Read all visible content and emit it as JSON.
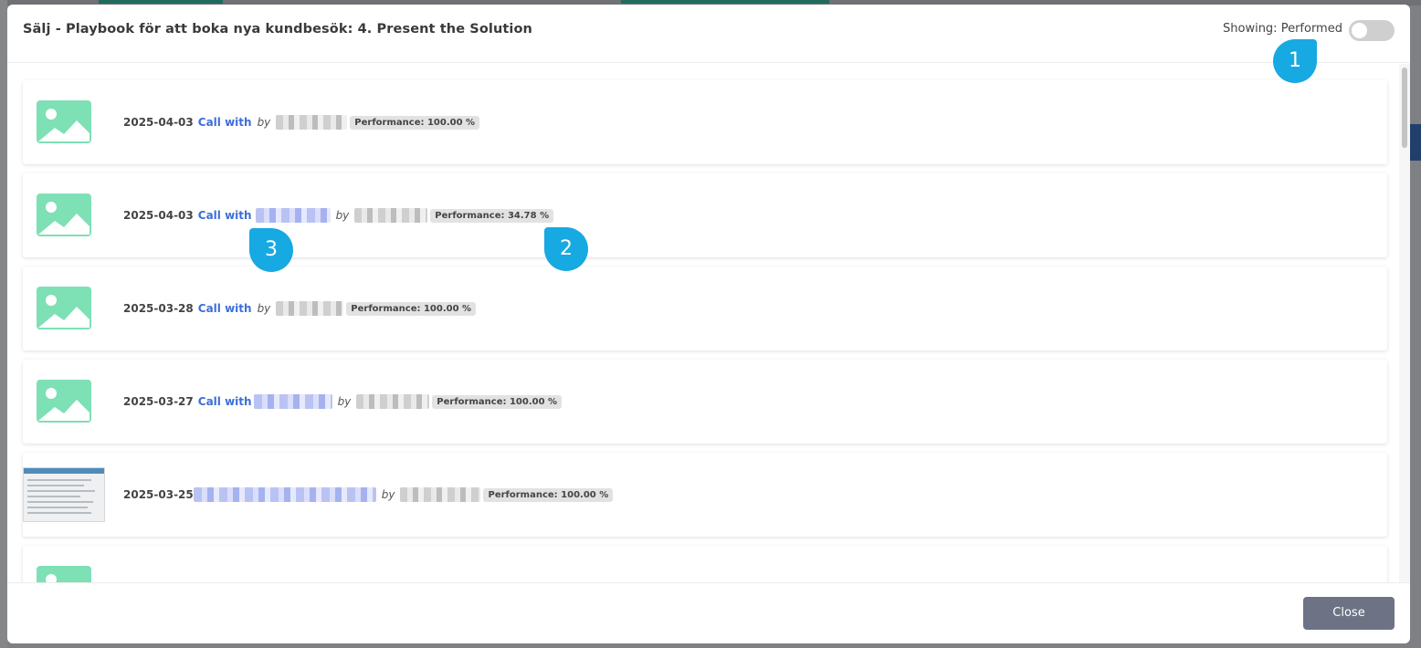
{
  "modal": {
    "title": "Sälj - Playbook för att boka nya kundbesök: 4. Present the Solution",
    "showing_label": "Showing: Performed",
    "toggle_on": false
  },
  "rows": [
    {
      "date": "2025-04-03",
      "call_with": "Call with",
      "by": "by",
      "performance": "Performance: 100.00 %",
      "thumbnail": "image-placeholder-icon"
    },
    {
      "date": "2025-04-03",
      "call_with": "Call with",
      "by": "by",
      "performance": "Performance: 34.78 %",
      "thumbnail": "image-placeholder-icon"
    },
    {
      "date": "2025-03-28",
      "call_with": "Call with",
      "by": "by",
      "performance": "Performance: 100.00 %",
      "thumbnail": "image-placeholder-icon"
    },
    {
      "date": "2025-03-27",
      "call_with": "Call with",
      "by": "by",
      "performance": "Performance: 100.00 %",
      "thumbnail": "image-placeholder-icon"
    },
    {
      "date": "2025-03-25",
      "call_with": "",
      "by": "by",
      "performance": "Performance: 100.00 %",
      "thumbnail": "screenshot-thumbnail"
    }
  ],
  "footer": {
    "close_label": "Close"
  },
  "markers": [
    {
      "label": "1"
    },
    {
      "label": "2"
    },
    {
      "label": "3"
    }
  ],
  "colors": {
    "accent": "#17a9e1",
    "link": "#3d6fd8",
    "thumb": "#7ee0b5",
    "close_button": "#6d7384"
  }
}
